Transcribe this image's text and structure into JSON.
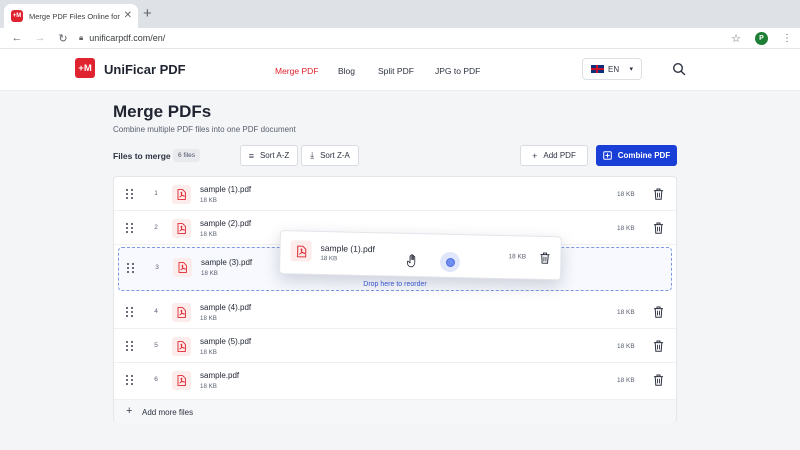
{
  "browser": {
    "tab_title": "Merge PDF Files Online for Free",
    "favicon_text": "+M",
    "url": "unificarpdf.com/en/",
    "profile_initial": "P"
  },
  "header": {
    "logo_text": "+M",
    "brand": "UniFicar PDF",
    "nav": [
      {
        "label": "Merge PDF",
        "active": true
      },
      {
        "label": "Blog",
        "active": false
      },
      {
        "label": "Split PDF",
        "active": false
      },
      {
        "label": "JPG to PDF",
        "active": false
      }
    ],
    "language": "EN"
  },
  "main": {
    "title": "Merge PDFs",
    "subtitle": "Combine multiple PDF files into one PDF document",
    "files_label": "Files to merge",
    "file_count": "6 files",
    "sort_az": "Sort A-Z",
    "sort_za": "Sort Z-A",
    "add_pdf": "Add PDF",
    "combine_pdf": "Combine PDF",
    "drop_text": "Drop here to reorder",
    "add_more": "Add more files"
  },
  "files": [
    {
      "index": "1",
      "name": "sample (1).pdf",
      "size": "18 KB"
    },
    {
      "index": "2",
      "name": "sample (2).pdf",
      "size": "18 KB"
    },
    {
      "index": "3",
      "name": "sample (3).pdf",
      "size": "18 KB"
    },
    {
      "index": "4",
      "name": "sample (4).pdf",
      "size": "18 KB"
    },
    {
      "index": "5",
      "name": "sample (5).pdf",
      "size": "18 KB"
    },
    {
      "index": "6",
      "name": "sample.pdf",
      "size": "18 KB"
    }
  ],
  "dragging": {
    "name": "sample (1).pdf",
    "size": "18 KB"
  },
  "colors": {
    "accent": "#e0242f",
    "primary": "#1a3fd6",
    "drop": "#3b5bd8"
  }
}
